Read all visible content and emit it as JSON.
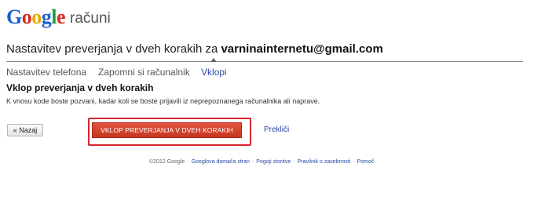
{
  "header": {
    "brand": "Google",
    "subtitle": "računi",
    "brand_colors": [
      "#1a5fd6",
      "#d62d20",
      "#e8a500",
      "#1a5fd6",
      "#1e9e3c",
      "#d62d20"
    ]
  },
  "title": {
    "prefix": "Nastavitev preverjanja v dveh korakih za",
    "email": "varninainternetu@gmail.com"
  },
  "steps": [
    {
      "label": "Nastavitev telefona",
      "active": false
    },
    {
      "label": "Zapomni si računalnik",
      "active": false
    },
    {
      "label": "Vklopi",
      "active": true
    }
  ],
  "section": {
    "heading": "Vklop preverjanja v dveh korakih",
    "description": "K vnosu kode boste pozvani, kadar koli se boste prijavili iz neprepoznanega računalnika ali naprave."
  },
  "actions": {
    "back_label": "« Nazaj",
    "primary_label": "VKLOP PREVERJANJA V DVEH KORAKIH",
    "cancel_label": "Prekliči",
    "primary_color": "#d2412a",
    "highlight_color": "#d8262d"
  },
  "footer": {
    "copyright": "©2012 Google",
    "links": [
      "Googlova domača stran",
      "Pogoji storitve",
      "Pravilnik o zasebnosti",
      "Pomoč"
    ]
  }
}
